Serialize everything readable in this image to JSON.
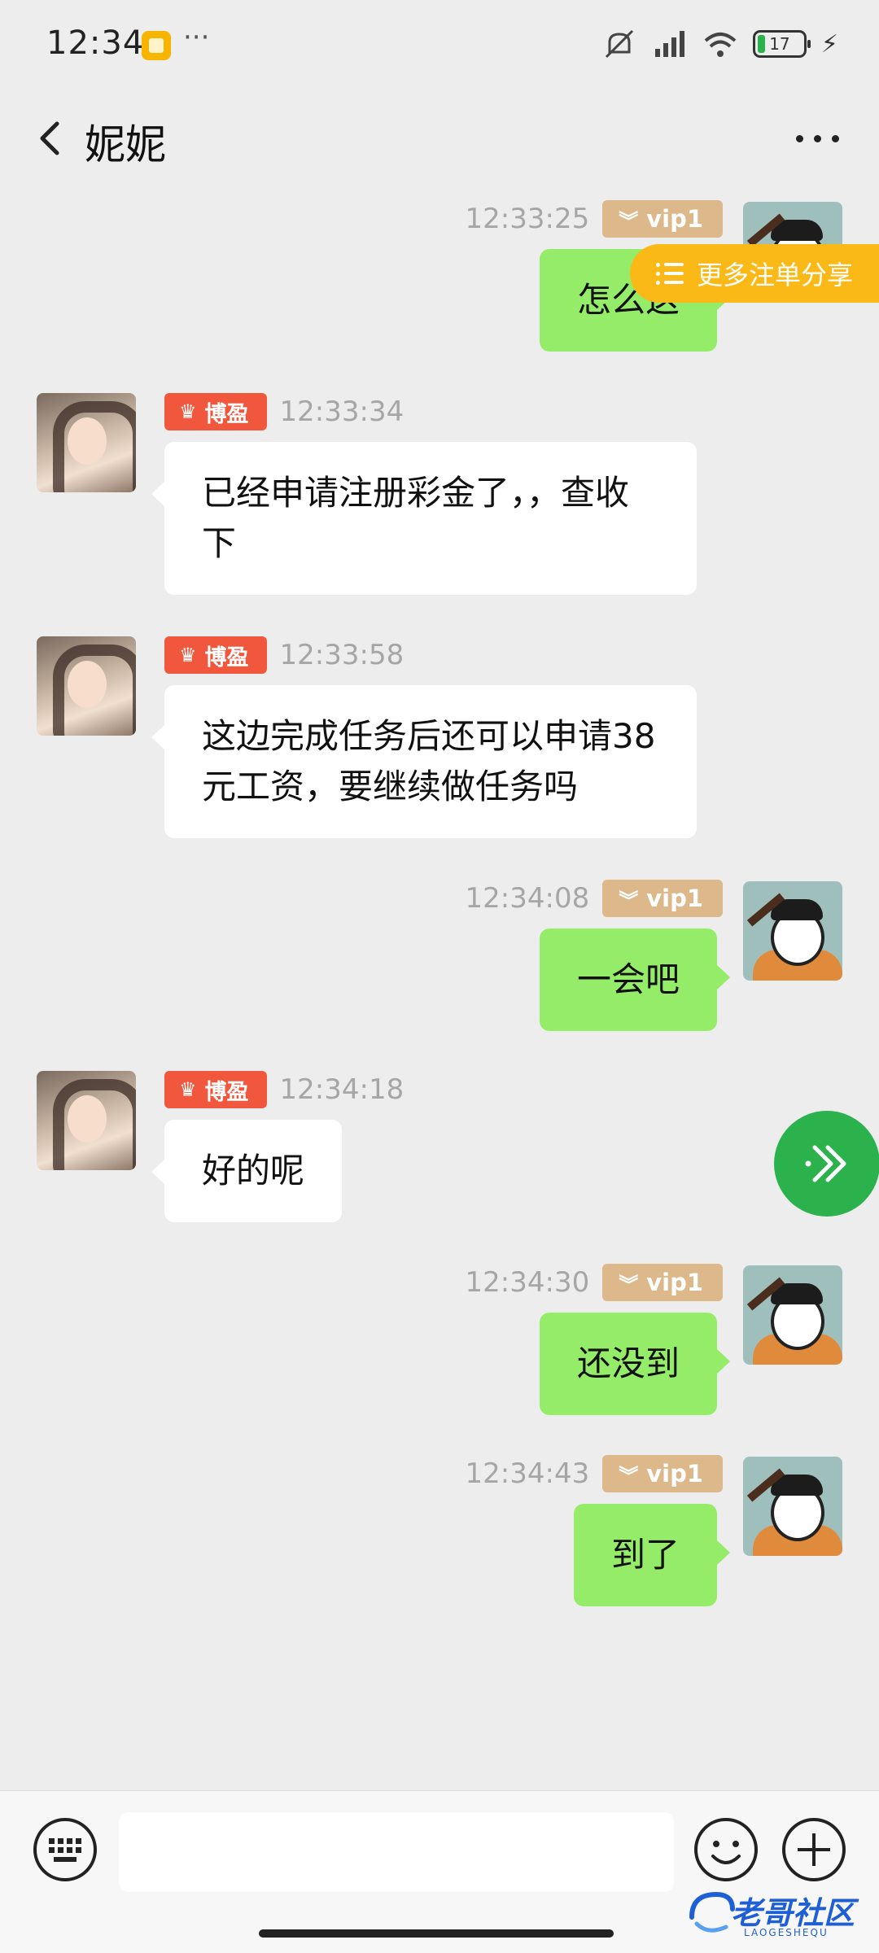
{
  "status_bar": {
    "time": "12:34",
    "more": "···",
    "battery": "17"
  },
  "header": {
    "title": "妮妮"
  },
  "share_pill": {
    "label": "更多注单分享"
  },
  "badges": {
    "her": "博盈",
    "me": "vip1"
  },
  "messages": [
    {
      "side": "me",
      "time": "12:33:25",
      "text": "怎么这"
    },
    {
      "side": "her",
      "time": "12:33:34",
      "text": "已经申请注册彩金了，，查收下"
    },
    {
      "side": "her",
      "time": "12:33:58",
      "text": "这边完成任务后还可以申请38元工资，要继续做任务吗"
    },
    {
      "side": "me",
      "time": "12:34:08",
      "text": "一会吧"
    },
    {
      "side": "her",
      "time": "12:34:18",
      "text": "好的呢"
    },
    {
      "side": "me",
      "time": "12:34:30",
      "text": "还没到"
    },
    {
      "side": "me",
      "time": "12:34:43",
      "text": "到了"
    }
  ],
  "input": {
    "value": ""
  },
  "watermark": {
    "text": "老哥社区",
    "sub": "LAOGESHEQU"
  },
  "colors": {
    "background": "#ededed",
    "my_bubble": "#95ec69",
    "her_bubble": "#ffffff",
    "vip_badge": "#dcb88a",
    "boying_badge": "#f1573d",
    "share_pill": "#fbb917",
    "fab": "#2bb24c"
  }
}
